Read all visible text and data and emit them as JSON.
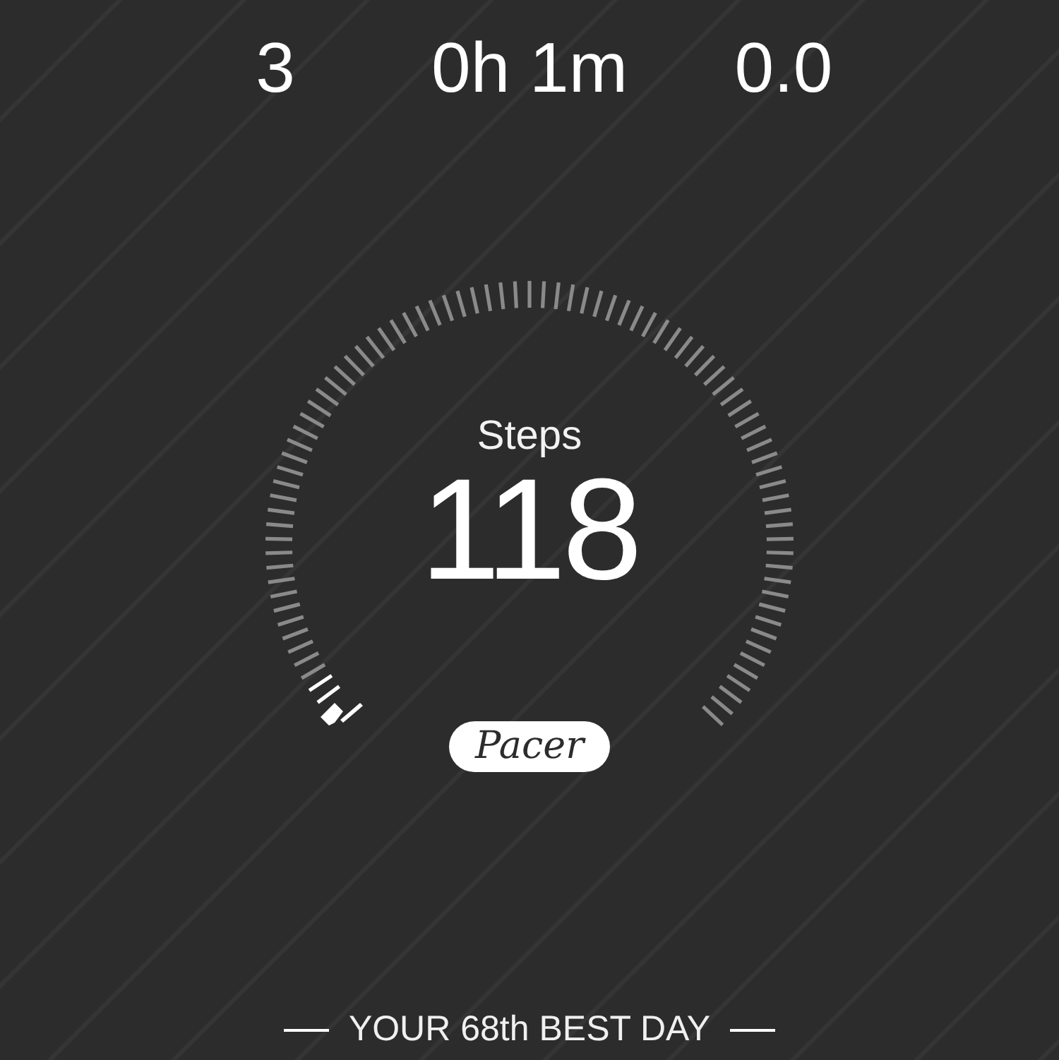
{
  "stats": [
    {
      "value": "3"
    },
    {
      "value": "0h 1m"
    },
    {
      "value": "0.0"
    }
  ],
  "gauge": {
    "label": "Steps",
    "value": "118",
    "brand": "Pacer"
  },
  "rank": {
    "text": "YOUR 68th BEST DAY"
  }
}
